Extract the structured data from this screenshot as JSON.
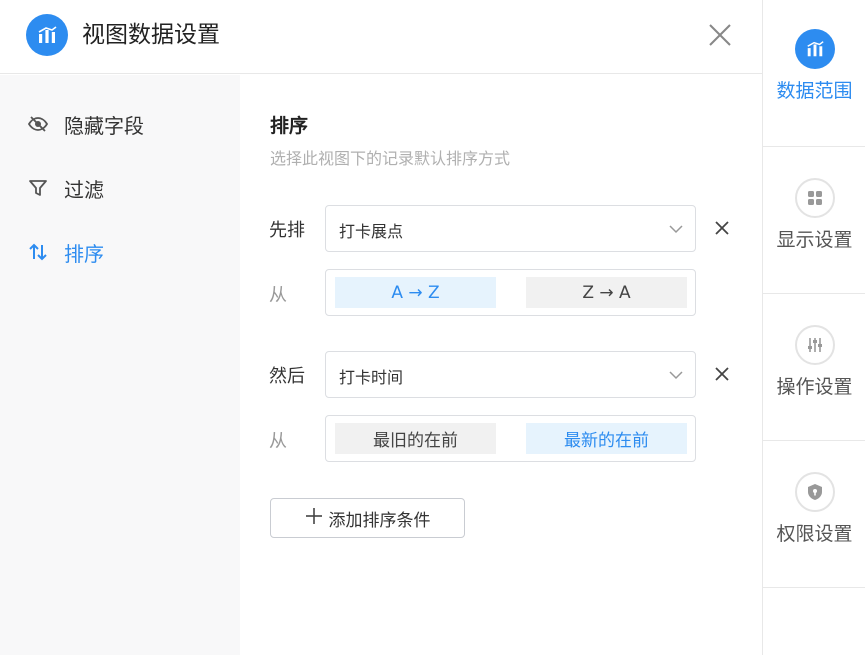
{
  "header": {
    "title": "视图数据设置"
  },
  "leftnav": {
    "items": [
      {
        "label": "隐藏字段",
        "icon": "eye-off-icon"
      },
      {
        "label": "过滤",
        "icon": "filter-icon"
      },
      {
        "label": "排序",
        "icon": "sort-icon"
      }
    ],
    "active_index": 2
  },
  "main": {
    "section_title": "排序",
    "section_desc": "选择此视图下的记录默认排序方式",
    "rules": [
      {
        "prefix": "先排",
        "field": "打卡展点",
        "from_label": "从",
        "options": [
          "A → Z",
          "Z → A"
        ],
        "selected": 0
      },
      {
        "prefix": "然后",
        "field": "打卡时间",
        "from_label": "从",
        "options": [
          "最旧的在前",
          "最新的在前"
        ],
        "selected": 1
      }
    ],
    "add_label": "添加排序条件"
  },
  "rightbar": {
    "tabs": [
      {
        "label": "数据范围",
        "icon": "chart-icon",
        "active": true
      },
      {
        "label": "显示设置",
        "icon": "grid-icon",
        "active": false
      },
      {
        "label": "操作设置",
        "icon": "sliders-icon",
        "active": false
      },
      {
        "label": "权限设置",
        "icon": "shield-icon",
        "active": false
      }
    ]
  },
  "colors": {
    "accent": "#2d8cf0",
    "accent_light": "#e6f3fd",
    "nav_bg": "#f8f8f9"
  }
}
